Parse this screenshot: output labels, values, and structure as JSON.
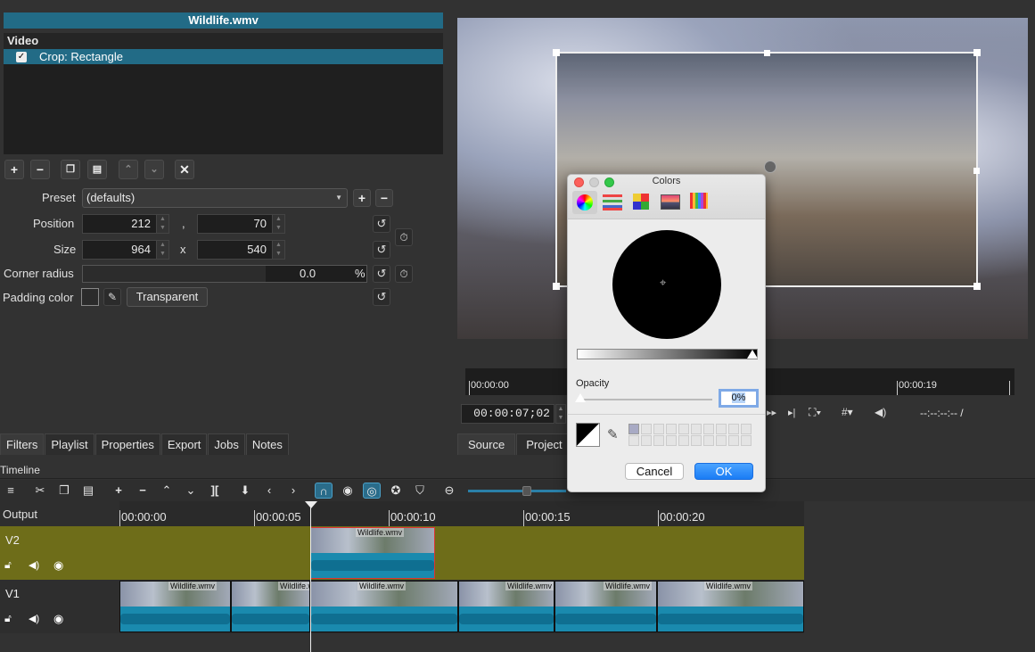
{
  "filters": {
    "clip_title": "Wildlife.wmv",
    "section_video": "Video",
    "filter_item": "Crop: Rectangle",
    "filter_checked": "✓",
    "preset_label": "Preset",
    "preset_value": "(defaults)",
    "position_label": "Position",
    "position_x": "212",
    "position_sep": ",",
    "position_y": "70",
    "size_label": "Size",
    "size_w": "964",
    "size_sep": "x",
    "size_h": "540",
    "corner_label": "Corner radius",
    "corner_value": "0.0",
    "corner_unit": "%",
    "padding_label": "Padding color",
    "transparent_button": "Transparent"
  },
  "left_tabs": [
    "Filters",
    "Playlist",
    "Properties",
    "Export",
    "Jobs",
    "Notes"
  ],
  "right_tabs": [
    "Source",
    "Project"
  ],
  "player": {
    "ruler_start": "00:00:00",
    "ruler_end": "00:00:19",
    "timecode": "00:00:07;02",
    "total_time": "--:--:--:-- /"
  },
  "timeline": {
    "title": "Timeline",
    "output_label": "Output",
    "ticks": [
      "00:00:00",
      "00:00:05",
      "00:00:10",
      "00:00:15",
      "00:00:20"
    ],
    "track_v2": "V2",
    "track_v1": "V1",
    "clip_name": "Wildlife.wmv"
  },
  "colors_dialog": {
    "title": "Colors",
    "opacity_label": "Opacity",
    "opacity_value": "0%",
    "cancel": "Cancel",
    "ok": "OK"
  },
  "colors": {
    "accent": "#226b86",
    "track_bg": "#6e6d19",
    "clip_selected_border": "#d33"
  }
}
